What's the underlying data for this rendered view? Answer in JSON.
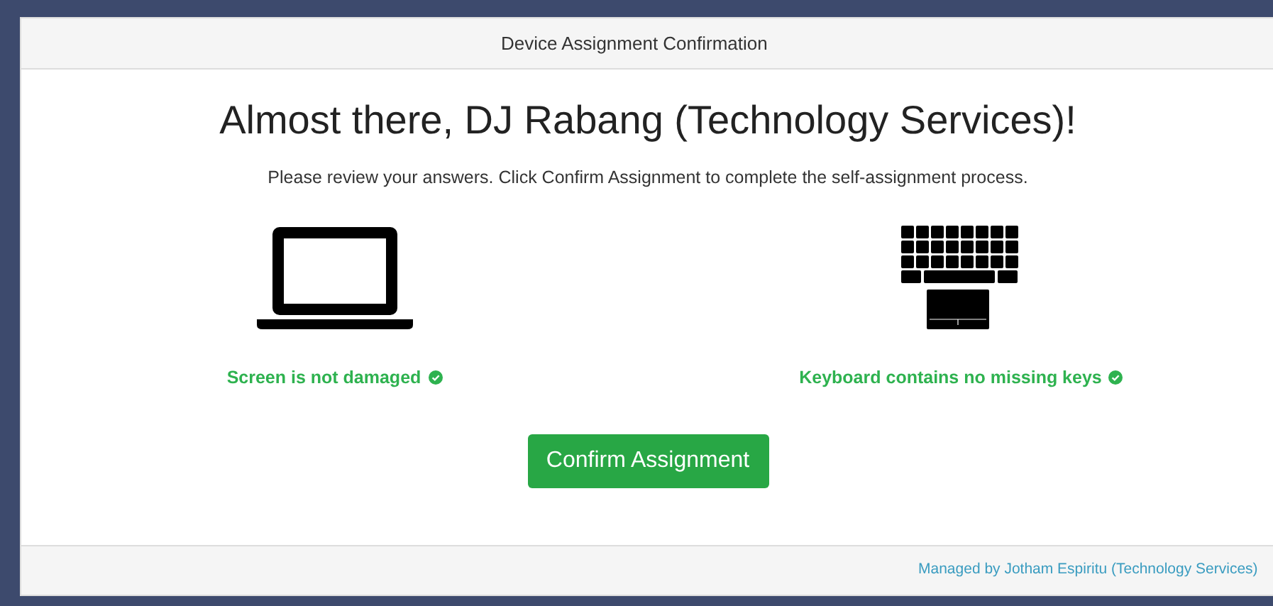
{
  "panel": {
    "title": "Device Assignment Confirmation"
  },
  "heading": "Almost there, DJ Rabang (Technology Services)!",
  "instructions": "Please review your answers. Click Confirm Assignment to complete the self-assignment process.",
  "checks": [
    {
      "kind": "laptop",
      "label": "Screen is not damaged",
      "checked": true
    },
    {
      "kind": "keyboard",
      "label": "Keyboard contains no missing keys",
      "checked": true
    }
  ],
  "confirm_button": "Confirm Assignment",
  "footer": "Managed by Jotham Espiritu (Technology Services)"
}
